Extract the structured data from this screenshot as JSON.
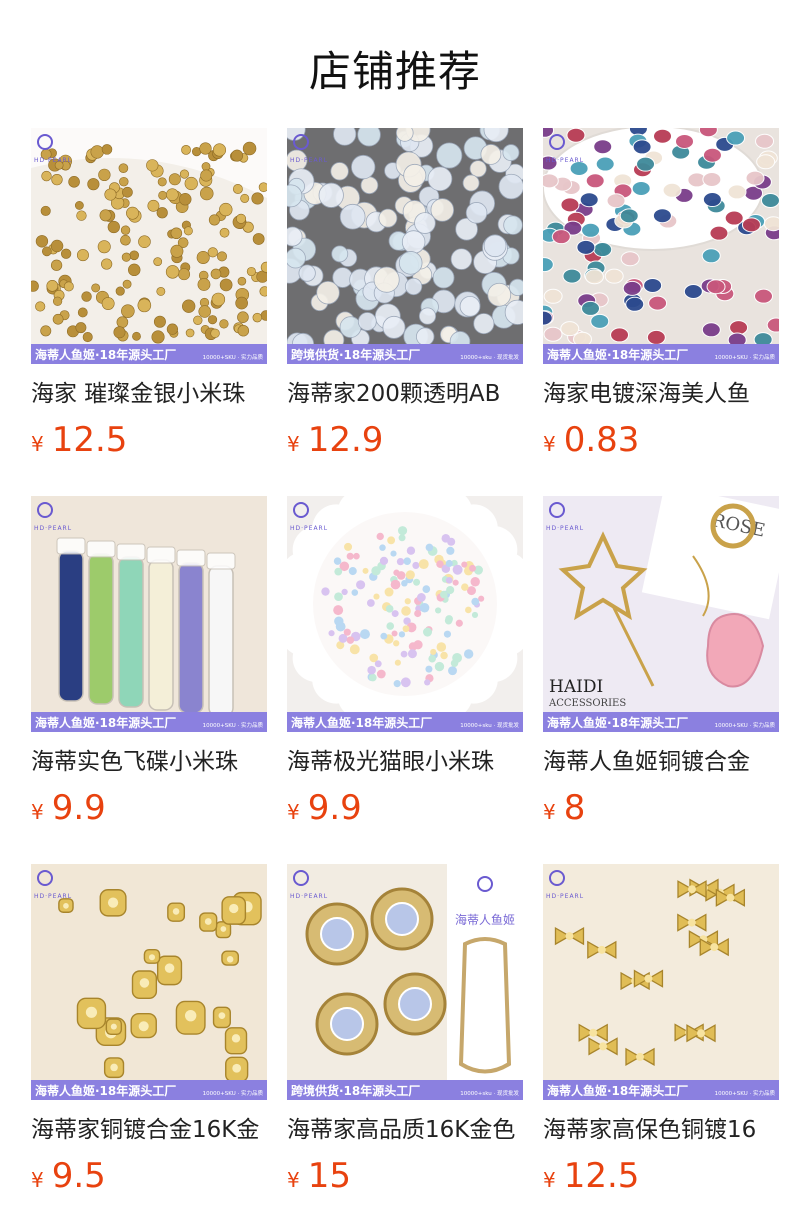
{
  "header": {
    "title": "店铺推荐"
  },
  "banner": {
    "logo_text": "HD·PEARL"
  },
  "products": [
    {
      "name": "海家 璀璨金银小米珠",
      "currency": "¥",
      "price": "12.5",
      "banner_left": "海蒂人鱼姬·18年源头工厂",
      "banner_right": "10000+SKU · 实力品质",
      "bg": "#f3efe9",
      "theme": "gold-seeds"
    },
    {
      "name": "海蒂家200颗透明AB",
      "currency": "¥",
      "price": "12.9",
      "banner_left": "跨境供货·18年源头工厂",
      "banner_right": "10000+sku · 现货批发",
      "bg": "#6e6e70",
      "theme": "crystal"
    },
    {
      "name": "海家电镀深海美人鱼",
      "currency": "¥",
      "price": "0.83",
      "banner_left": "海蒂人鱼姬·18年源头工厂",
      "banner_right": "10000+SKU · 实力品质",
      "bg": "#e9e3de",
      "theme": "rainbow-pearls"
    },
    {
      "name": "海蒂实色飞碟小米珠",
      "currency": "¥",
      "price": "9.9",
      "banner_left": "海蒂人鱼姬·18年源头工厂",
      "banner_right": "10000+SKU · 实力品质",
      "bg": "#efe6da",
      "theme": "tubes"
    },
    {
      "name": "海蒂极光猫眼小米珠",
      "currency": "¥",
      "price": "9.9",
      "banner_left": "海蒂人鱼姬·18年源头工厂",
      "banner_right": "10000+sku · 现货批发",
      "bg": "#e8e6e4",
      "theme": "pastel-tray"
    },
    {
      "name": "海蒂人鱼姬铜镀合金",
      "currency": "¥",
      "price": "8",
      "banner_left": "海蒂人鱼姬·18年源头工厂",
      "banner_right": "10000+SKU · 实力品质",
      "bg": "#eeeaf3",
      "theme": "charms",
      "brand_text": "HAIDI",
      "brand_sub": "ACCESSORIES",
      "card_text": "ROSE"
    },
    {
      "name": "海蒂家铜镀合金16K金",
      "currency": "¥",
      "price": "9.5",
      "banner_left": "海蒂人鱼姬·18年源头工厂",
      "banner_right": "10000+SKU · 实力品质",
      "bg": "#f1e7d6",
      "theme": "gold-spacers"
    },
    {
      "name": "海蒂家高品质16K金色",
      "currency": "¥",
      "price": "15",
      "banner_left": "跨境供货·18年源头工厂",
      "banner_right": "10000+sku · 现货批发",
      "bg": "#f2ece2",
      "theme": "flower-set",
      "side_text": "海蒂人鱼姬"
    },
    {
      "name": "海蒂家高保色铜镀16",
      "currency": "¥",
      "price": "12.5",
      "banner_left": "海蒂人鱼姬·18年源头工厂",
      "banner_right": "10000+SKU · 实力品质",
      "bg": "#f3ebdc",
      "theme": "gold-bows"
    }
  ]
}
